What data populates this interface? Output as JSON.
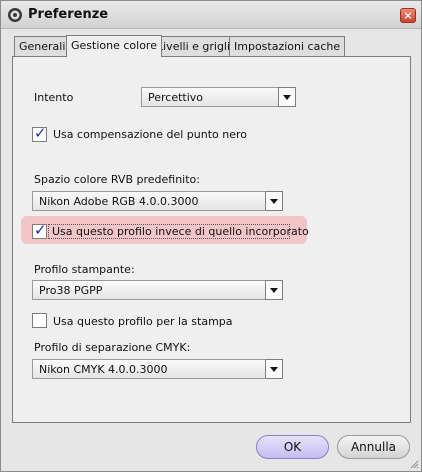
{
  "window": {
    "title": "Preferenze"
  },
  "tabs": [
    {
      "label": "Generali"
    },
    {
      "label": "Gestione colore"
    },
    {
      "label": "Livelli e griglia"
    },
    {
      "label": "Impostazioni cache"
    }
  ],
  "active_tab": "Gestione colore",
  "intent": {
    "label": "Intento",
    "value": "Percettivo"
  },
  "black_point": {
    "label": "Usa compensazione del punto nero",
    "checked": true
  },
  "rgb_space": {
    "label": "Spazio colore RVB predefinito:",
    "value": "Nikon Adobe RGB 4.0.0.3000"
  },
  "use_profile_instead": {
    "label": "Usa questo profilo invece di quello incorporato",
    "checked": true
  },
  "printer_profile": {
    "label": "Profilo stampante:",
    "value": "Pro38 PGPP"
  },
  "use_for_print": {
    "label": "Usa questo profilo per la stampa",
    "checked": false
  },
  "cmyk_profile": {
    "label": "Profilo di separazione CMYK:",
    "value": "Nikon CMYK 4.0.0.3000"
  },
  "buttons": {
    "ok": "OK",
    "cancel": "Annulla"
  },
  "icons": {
    "close": "×",
    "check": "✓"
  },
  "colors": {
    "highlight": "#f2c6c6",
    "ok_button": "#c6bdf0",
    "check_mark": "#2a2aa6"
  }
}
